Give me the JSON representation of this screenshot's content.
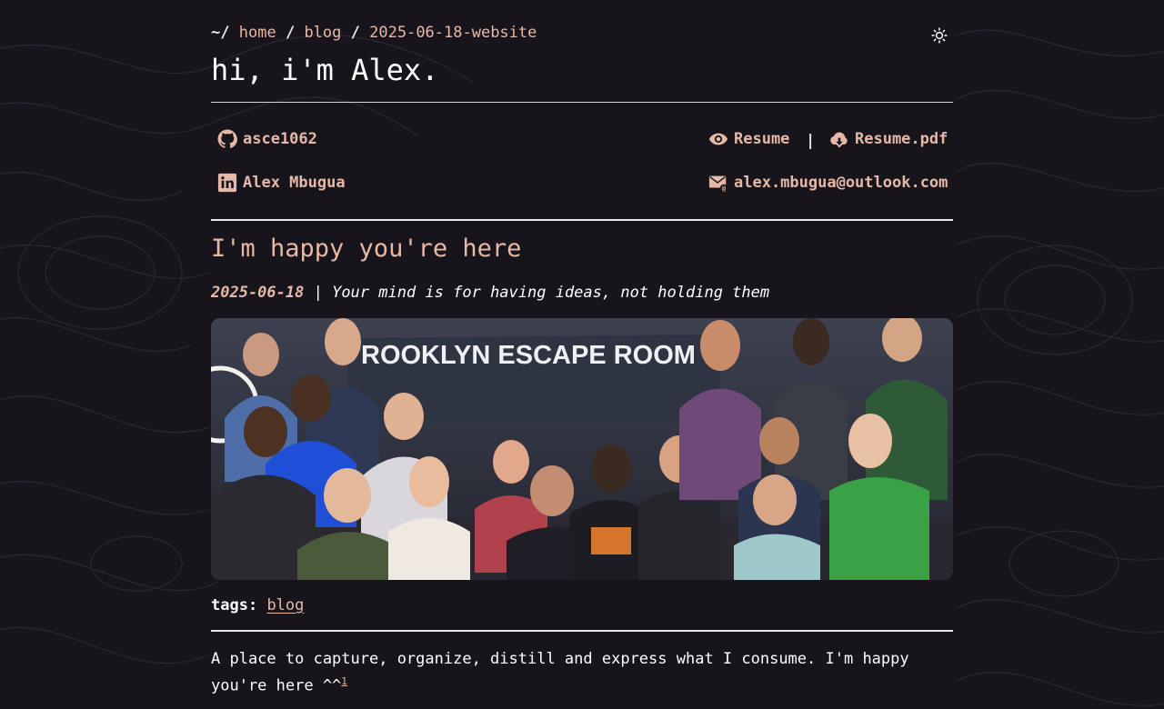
{
  "breadcrumb": {
    "root": "~/",
    "separator": "/",
    "items": [
      "home",
      "blog",
      "2025-06-18-website"
    ]
  },
  "header": {
    "title": "hi, i'm Alex."
  },
  "links": {
    "github": {
      "label": "asce1062",
      "icon": "github-icon"
    },
    "linkedin": {
      "label": "Alex Mbugua",
      "icon": "linkedin-icon"
    },
    "resume": {
      "label": "Resume",
      "icon": "eye-icon"
    },
    "resume_pdf": {
      "label": "Resume.pdf",
      "icon": "cloud-download-icon"
    },
    "email": {
      "label": "alex.mbugua@outlook.com",
      "icon": "mail-icon"
    },
    "pipe": "|"
  },
  "post": {
    "title": "I'm happy you're here",
    "date": "2025-06-18",
    "meta_sep": " | ",
    "subtitle": "Your mind is for having ideas, not holding them",
    "image_banner_text": "ROOKLYN ESCAPE ROOM"
  },
  "tags": {
    "label": "tags:",
    "items": [
      "blog"
    ]
  },
  "intro": {
    "text": "A place to capture, organize, distill and express what I consume. I'm happy you're here ^^",
    "footnote": "1"
  },
  "colors": {
    "background": "#17141c",
    "accent": "#e6b8a6",
    "text": "#ffffff"
  }
}
